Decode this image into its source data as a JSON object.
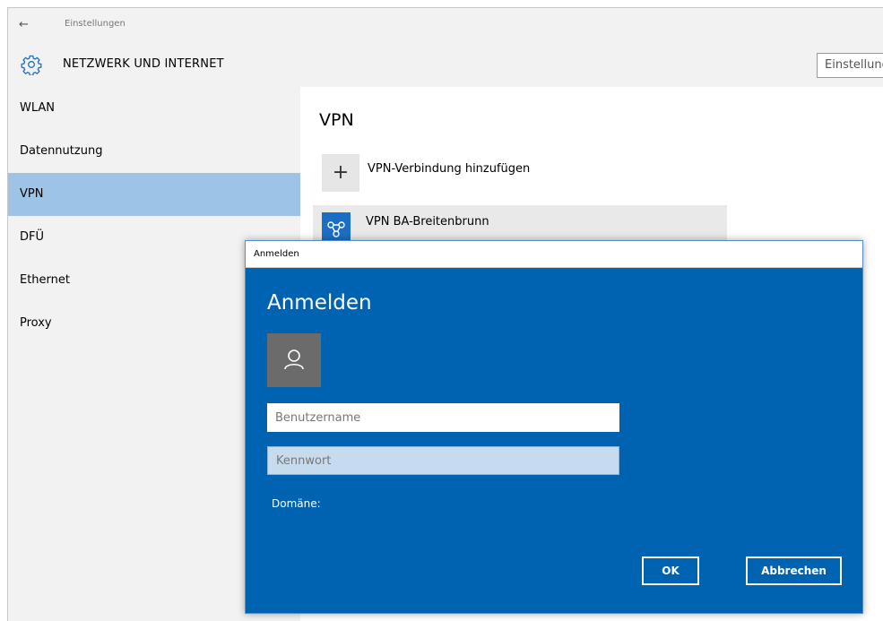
{
  "window": {
    "title": "Einstellungen",
    "back_icon": "back-arrow-icon",
    "back_glyph": "←"
  },
  "header": {
    "icon": "gear-icon",
    "title": "NETZWERK UND INTERNET",
    "search_placeholder": "Einstellung suchen"
  },
  "sidebar": {
    "items": [
      {
        "label": "WLAN",
        "active": false
      },
      {
        "label": "Datennutzung",
        "active": false
      },
      {
        "label": "VPN",
        "active": true
      },
      {
        "label": "DFÜ",
        "active": false
      },
      {
        "label": "Ethernet",
        "active": false
      },
      {
        "label": "Proxy",
        "active": false
      }
    ],
    "active_color": "#9dc3e6"
  },
  "content": {
    "title": "VPN",
    "add_label": "VPN-Verbindung hinzufügen",
    "add_glyph": "+",
    "add_icon": "plus-icon",
    "connection_name": "VPN BA-Breitenbrunn",
    "connection_icon": "vpn-icon"
  },
  "dialog": {
    "window_title": "Anmelden",
    "heading": "Anmelden",
    "avatar_icon": "user-icon",
    "username_placeholder": "Benutzername",
    "password_placeholder": "Kennwort",
    "domain_label": "Domäne:",
    "ok_label": "OK",
    "cancel_label": "Abbrechen",
    "background_color": "#0063b1"
  }
}
